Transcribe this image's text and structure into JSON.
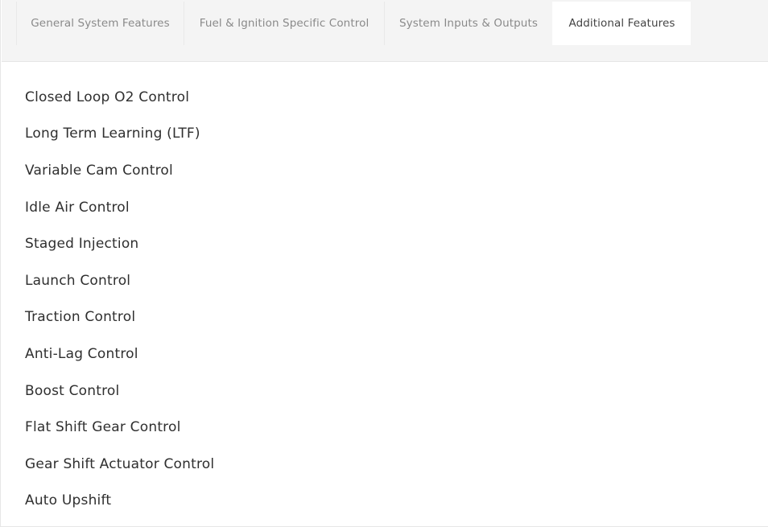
{
  "tabs": [
    {
      "label": "General System Features",
      "active": false
    },
    {
      "label": "Fuel & Ignition Specific Control",
      "active": false
    },
    {
      "label": "System Inputs & Outputs",
      "active": false
    },
    {
      "label": "Additional Features",
      "active": true
    }
  ],
  "features": [
    "Closed Loop O2 Control",
    "Long Term Learning (LTF)",
    "Variable Cam Control",
    "Idle Air Control",
    "Staged Injection",
    "Launch Control",
    "Traction Control",
    "Anti-Lag Control",
    "Boost Control",
    "Flat Shift Gear Control",
    "Gear Shift Actuator Control",
    "Auto Upshift"
  ]
}
